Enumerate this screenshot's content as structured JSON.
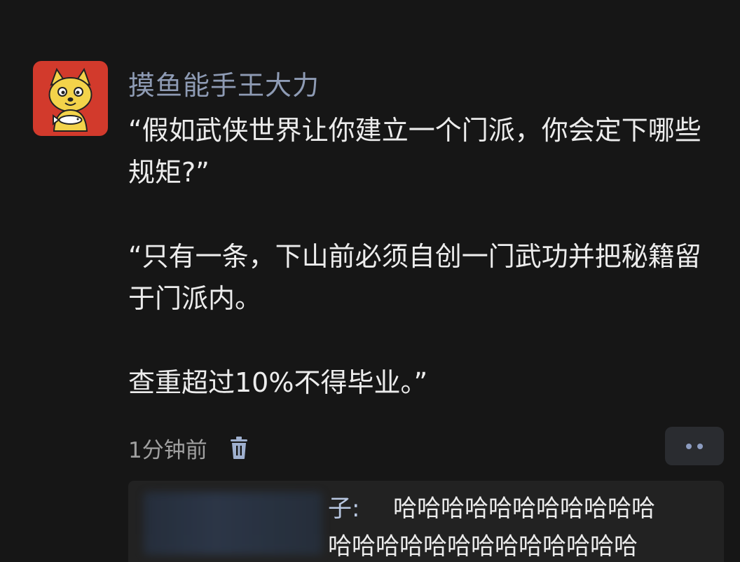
{
  "post": {
    "username": "摸鱼能手王大力",
    "paragraphs": [
      "“假如武侠世界让你建立一个门派，你会定下哪些规矩?”",
      "“只有一条，下山前必须自创一门武功并把秘籍留于门派内。",
      "查重超过10%不得毕业。”"
    ],
    "timestamp": "1分钟前",
    "icons": {
      "avatar": "doge-cat-avatar",
      "delete": "trash-icon",
      "more": "more-dots-icon"
    }
  },
  "reply": {
    "author_fragment": "子:",
    "line1": " 哈哈哈哈哈哈哈哈哈哈哈",
    "line2": "哈哈哈哈哈哈哈哈哈哈哈哈哈"
  },
  "colors": {
    "background": "#161616",
    "username": "#8e9bb4",
    "text": "#ececec",
    "avatar_bg": "#d23a2c"
  }
}
